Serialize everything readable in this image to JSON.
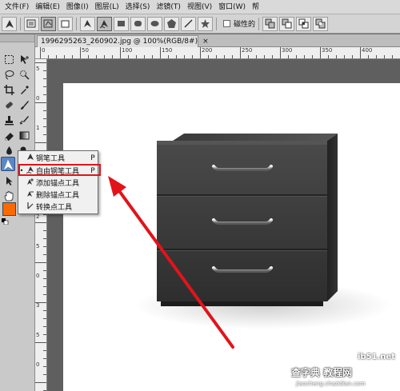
{
  "menubar": {
    "items": [
      {
        "label": "文件(F)"
      },
      {
        "label": "编辑(E)"
      },
      {
        "label": "图像(I)"
      },
      {
        "label": "图层(L)"
      },
      {
        "label": "选择(S)"
      },
      {
        "label": "滤镜(T)"
      },
      {
        "label": "视图(V)"
      },
      {
        "label": "窗口(W)"
      },
      {
        "label": "帮"
      }
    ]
  },
  "options": {
    "magnetic_label": "磁性的"
  },
  "document": {
    "tab_title": "1996295263_260902.jpg @ 100%(RGB/8#)",
    "close_glyph": "×"
  },
  "rulers": {
    "top_numbers": [
      "0",
      "50",
      "100",
      "150",
      "200",
      "250",
      "300",
      "350",
      "400",
      "450"
    ],
    "left_numbers": [
      "5",
      "0",
      "1",
      "5",
      "0",
      "2",
      "5",
      "0",
      "3",
      "5",
      "0"
    ]
  },
  "flyout": {
    "items": [
      {
        "label": "钢笔工具",
        "key": "P",
        "icon": "pen-icon",
        "selected": false
      },
      {
        "label": "自由钢笔工具",
        "key": "P",
        "icon": "freeform-pen-icon",
        "selected": true
      },
      {
        "label": "添加锚点工具",
        "key": "",
        "icon": "add-anchor-icon",
        "selected": false
      },
      {
        "label": "删除锚点工具",
        "key": "",
        "icon": "delete-anchor-icon",
        "selected": false
      },
      {
        "label": "转换点工具",
        "key": "",
        "icon": "convert-point-icon",
        "selected": false
      }
    ],
    "bullet": "•"
  },
  "colors": {
    "foreground_swatch": "#fa6a00",
    "highlight_box": "#e1141a",
    "arrow": "#e1141a"
  },
  "watermark": {
    "line1": "查字典 教程网",
    "line2": "jiaocheng.chazidian.com",
    "corner": "ib51.net"
  }
}
